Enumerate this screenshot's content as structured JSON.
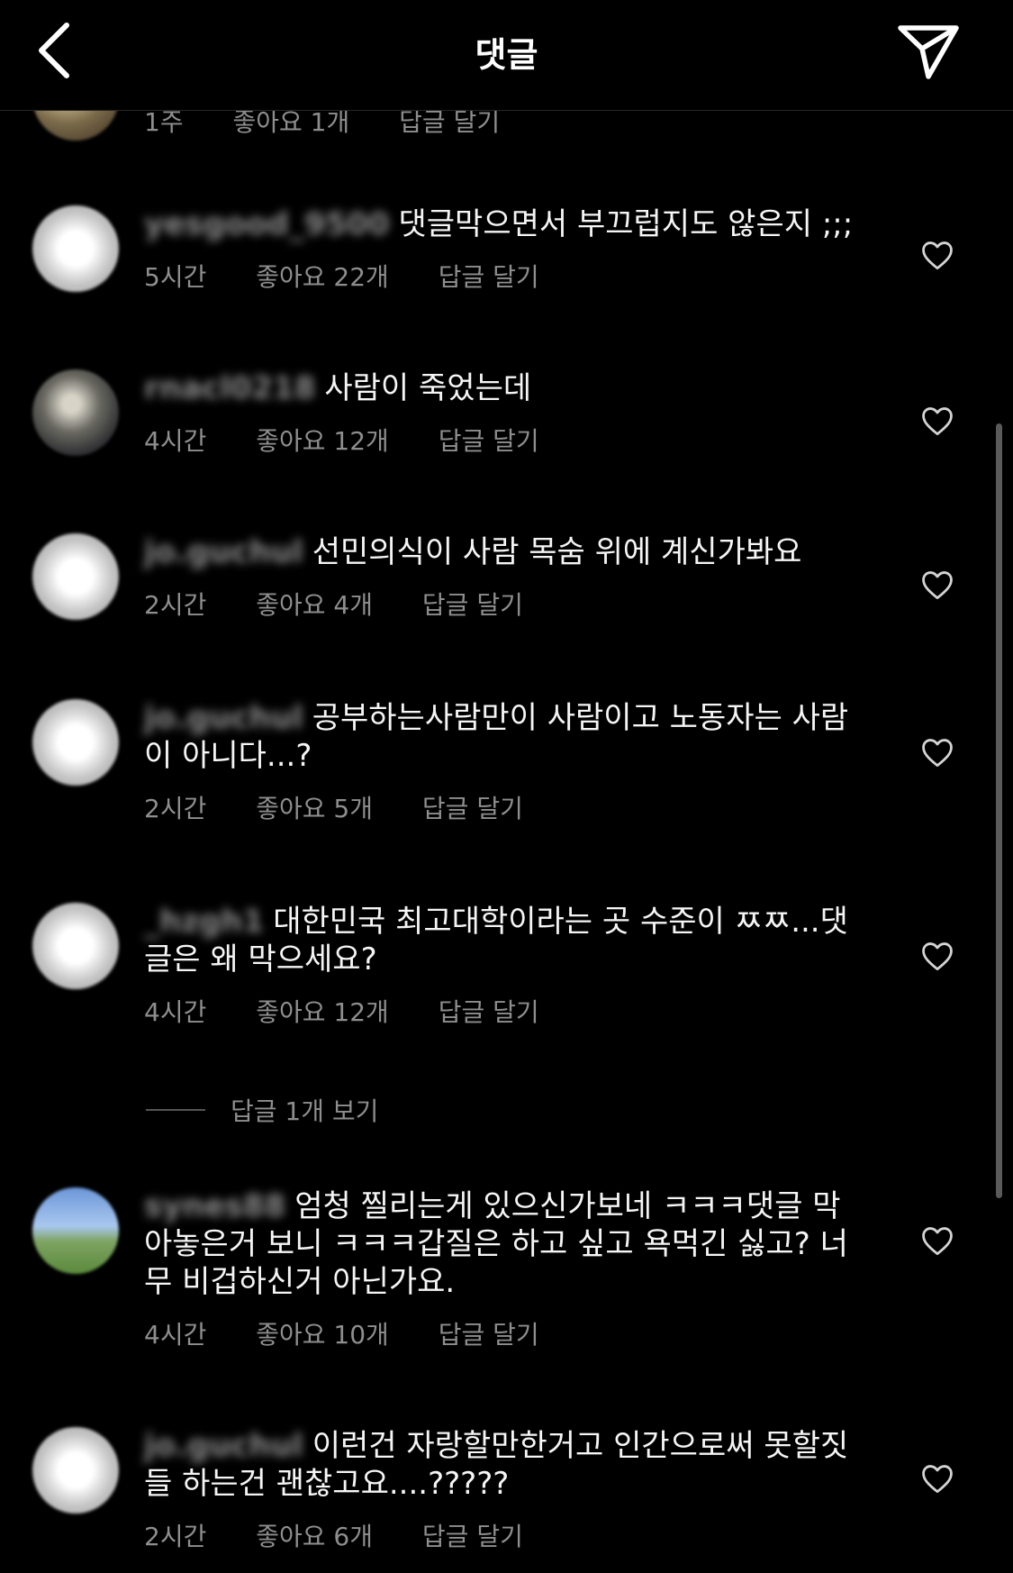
{
  "header": {
    "title": "댓글",
    "back_icon": "chevron-left-icon",
    "send_icon": "paper-plane-icon"
  },
  "partial_comment": {
    "time": "1주",
    "likes": "좋아요 1개",
    "reply": "답글 달기"
  },
  "comments": [
    {
      "username": "yesgood_9500",
      "text": "댓글막으면서 부끄럽지도 않은지 ;;;",
      "time": "5시간",
      "likes": "좋아요 22개",
      "reply": "답글 달기"
    },
    {
      "username": "rnacl0218",
      "text": "사람이 죽었는데",
      "time": "4시간",
      "likes": "좋아요 12개",
      "reply": "답글 달기"
    },
    {
      "username": "jo.guchul",
      "text": "선민의식이 사람 목숨 위에 계신가봐요",
      "time": "2시간",
      "likes": "좋아요 4개",
      "reply": "답글 달기"
    },
    {
      "username": "jo.guchul",
      "text": "공부하는사람만이 사람이고 노동자는 사람이 아니다...?",
      "time": "2시간",
      "likes": "좋아요 5개",
      "reply": "답글 달기"
    },
    {
      "username": "_hzgh1",
      "text": "대한민국 최고대학이라는 곳 수준이 ㅉㅉ...댓글은 왜 막으세요?",
      "time": "4시간",
      "likes": "좋아요 12개",
      "reply": "답글 달기"
    },
    {
      "username": "synes88",
      "text": "엄청 찔리는게 있으신가보네 ㅋㅋㅋ댓글 막아놓은거 보니 ㅋㅋㅋ갑질은 하고 싶고 욕먹긴 싫고? 너무 비겁하신거 아닌가요.",
      "time": "4시간",
      "likes": "좋아요 10개",
      "reply": "답글 달기"
    },
    {
      "username": "jo.guchul",
      "text": "이런건 자랑할만한거고 인간으로써 못할짓들 하는건 괜찮고요....?????",
      "time": "2시간",
      "likes": "좋아요 6개",
      "reply": "답글 달기"
    }
  ],
  "view_replies": "답글 1개 보기",
  "heart_icon": "heart-outline-icon"
}
